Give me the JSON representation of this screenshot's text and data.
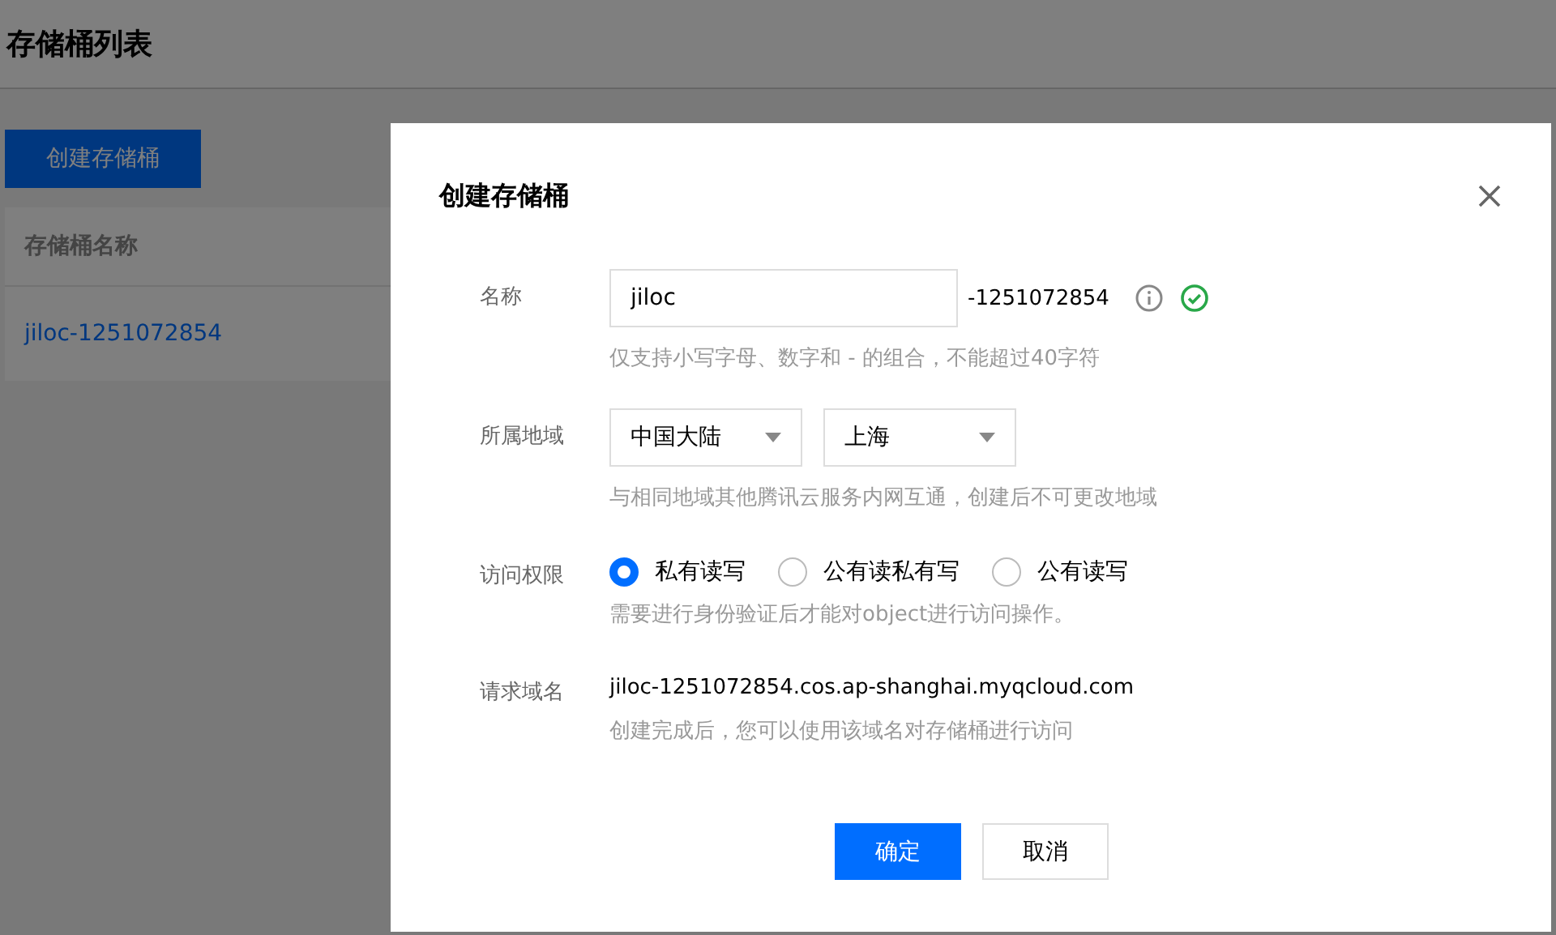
{
  "page": {
    "title": "存储桶列表",
    "create_button": "创建存储桶",
    "table": {
      "columns": [
        "存储桶名称"
      ],
      "rows": [
        {
          "name": "jiloc-1251072854"
        }
      ]
    }
  },
  "dialog": {
    "title": "创建存储桶",
    "name_field": {
      "label": "名称",
      "value": "jiloc",
      "suffix": "-1251072854",
      "valid": true,
      "hint": "仅支持小写字母、数字和 - 的组合，不能超过40字符"
    },
    "region": {
      "label": "所属地域",
      "selects": [
        "中国大陆",
        "上海"
      ],
      "hint": "与相同地域其他腾讯云服务内网互通，创建后不可更改地域"
    },
    "access": {
      "label": "访问权限",
      "options": [
        {
          "label": "私有读写",
          "selected": true
        },
        {
          "label": "公有读私有写",
          "selected": false
        },
        {
          "label": "公有读写",
          "selected": false
        }
      ],
      "hint": "需要进行身份验证后才能对object进行访问操作。"
    },
    "domain": {
      "label": "请求域名",
      "value": "jiloc-1251072854.cos.ap-shanghai.myqcloud.com",
      "hint": "创建完成后，您可以使用该域名对存储桶进行访问"
    },
    "buttons": [
      "确定",
      "取消"
    ]
  }
}
